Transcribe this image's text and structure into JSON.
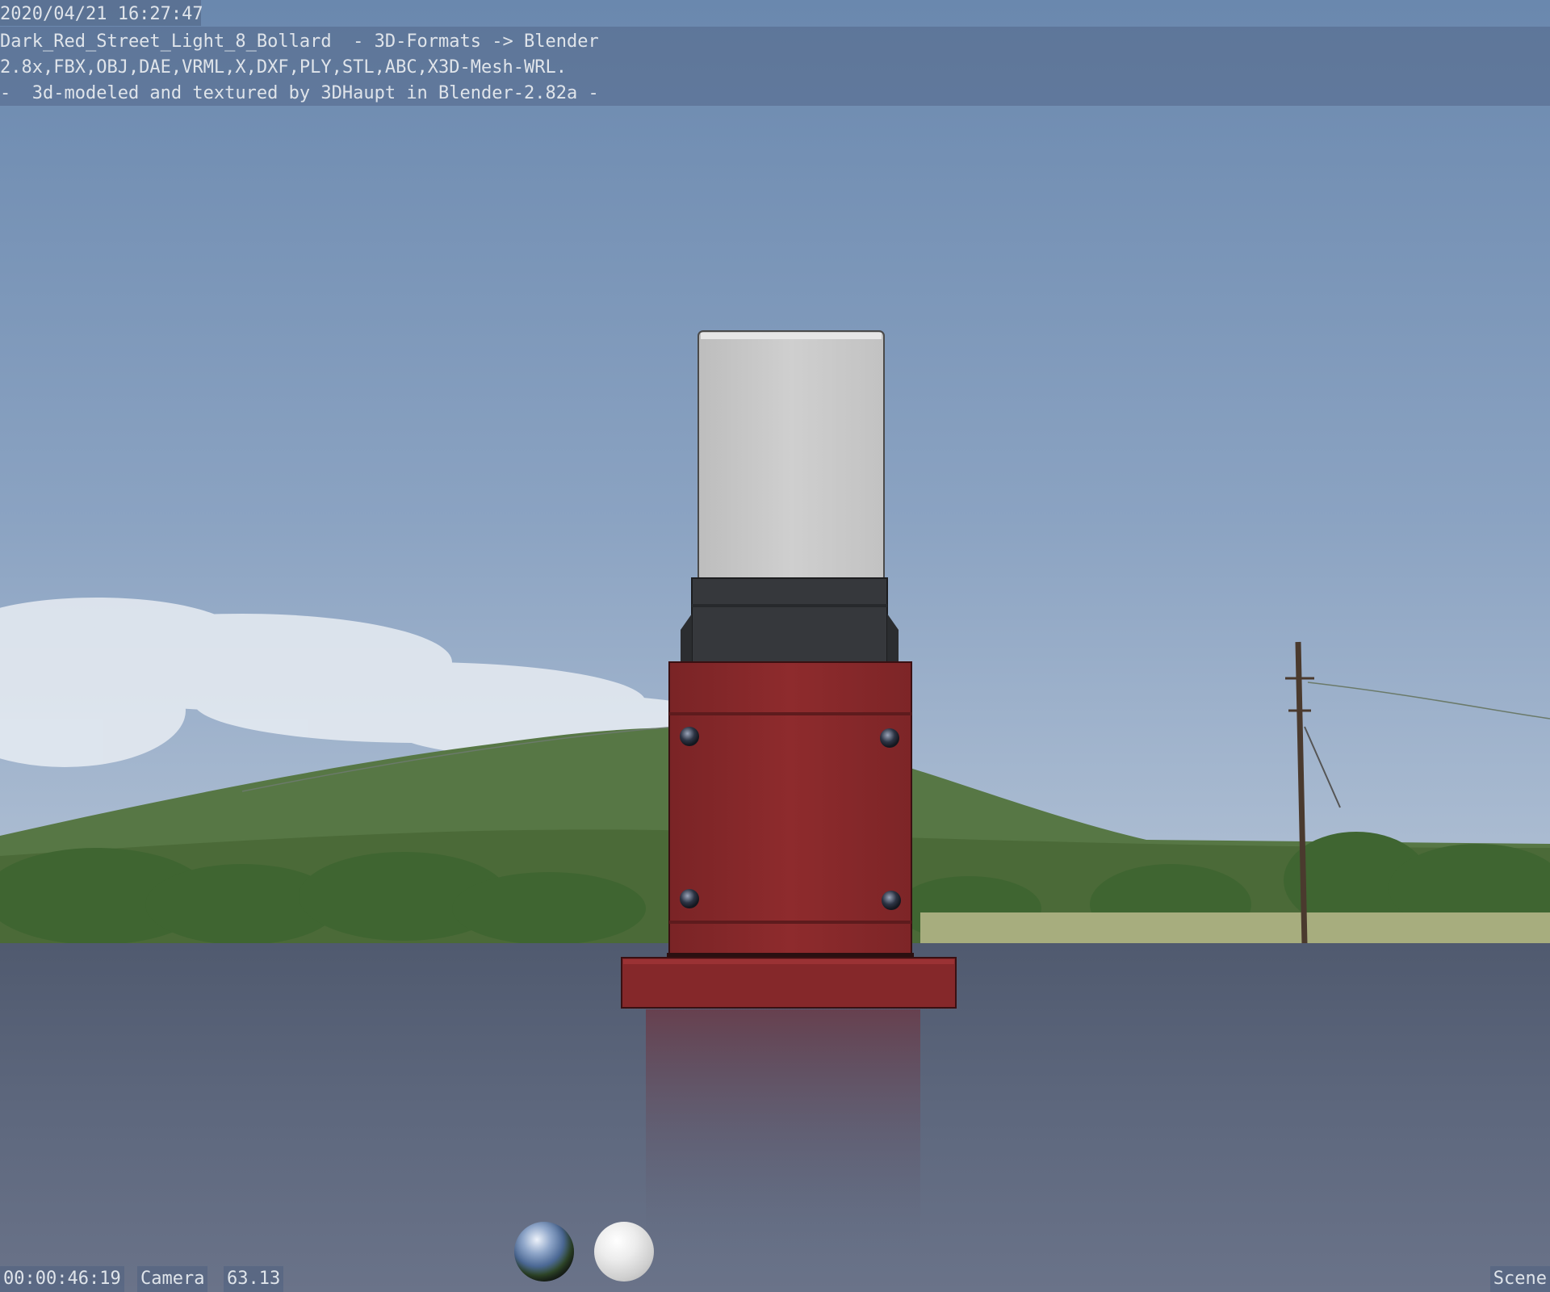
{
  "overlay": {
    "timestamp": "2020/04/21 16:27:47",
    "lines": [
      "Dark_Red_Street_Light_8_Bollard  - 3D-Formats -> Blender",
      "2.8x,FBX,OBJ,DAE,VRML,X,DXF,PLY,STL,ABC,X3D-Mesh-WRL.",
      "-  3d-modeled and textured by 3DHaupt in Blender-2.82a -"
    ]
  },
  "footer": {
    "timecode": "00:00:46:19",
    "camera": "Camera",
    "lens": "63.13",
    "scene": "Scene"
  },
  "lookdev": {
    "hdri_ball": "hdri-preview-sphere",
    "matcap_ball": "diffuse-preview-sphere"
  },
  "colors": {
    "sky_top": "#6d8bb1",
    "sky_bottom": "#a9bad0",
    "bollard_red": "#8c2a2c",
    "lamp_lens": "#c8c8c8",
    "housing": "#3b3d40",
    "floor": "#5b6479"
  }
}
